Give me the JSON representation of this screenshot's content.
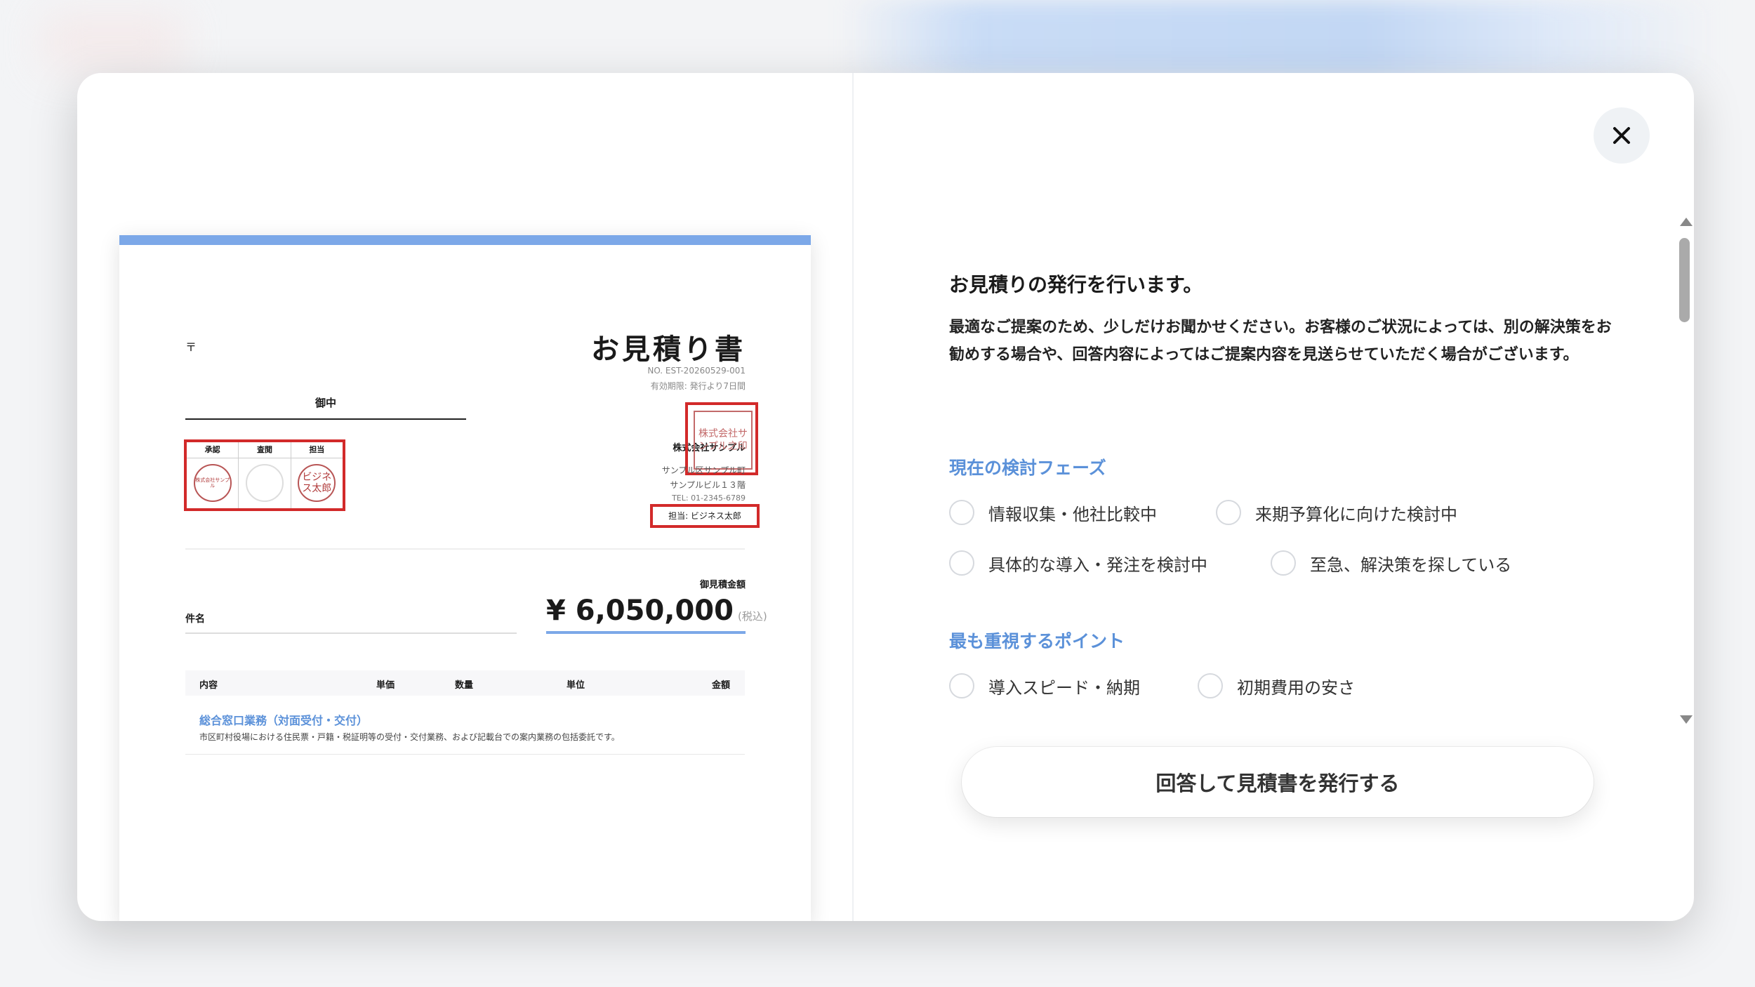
{
  "document": {
    "postal_mark": "〒",
    "title": "お見積り書",
    "number": "NO. EST-20260529-001",
    "validity": "有効期限: 発行より7日間",
    "recipient_suffix": "御中",
    "approval": {
      "headers": [
        "承認",
        "査閲",
        "担当"
      ],
      "seals": [
        "株式会社サンプル",
        "",
        "ビジネス太郎"
      ]
    },
    "company_stamp": "株式会社サンプル之印",
    "company_name": "株式会社サンプル",
    "address_line1": "サンプル区サンプル町",
    "address_line2": "サンプルビル１３階",
    "tel": "TEL: 01-2345-6789",
    "person_in_charge": "担当: ビジネス太郎",
    "amount_label": "御見積金額",
    "subject_label": "件名",
    "amount_value": "¥ 6,050,000",
    "amount_tax": "(税込)",
    "table_headers": [
      "内容",
      "単価",
      "数量",
      "単位",
      "金額"
    ],
    "items": [
      {
        "title": "総合窓口業務（対面受付・交付）",
        "description": "市区町村役場における住民票・戸籍・税証明等の受付・交付業務、および記載台での案内業務の包括委託です。"
      }
    ]
  },
  "form": {
    "title": "お見積りの発行を行います。",
    "intro": "最適なご提案のため、少しだけお聞かせください。お客様のご状況によっては、別の解決策をお勧めする場合や、回答内容によってはご提案内容を見送らせていただく場合がございます。",
    "sections": [
      {
        "title": "現在の検討フェーズ",
        "options": [
          "情報収集・他社比較中",
          "来期予算化に向けた検討中",
          "具体的な導入・発注を検討中",
          "至急、解決策を探している"
        ]
      },
      {
        "title": "最も重視するポイント",
        "options": [
          "導入スピード・納期",
          "初期費用の安さ"
        ]
      }
    ],
    "submit_label": "回答して見積書を発行する"
  },
  "colors": {
    "accent": "#5b91d9",
    "doc_bar": "#7ca8e8",
    "highlight_box": "#d22a2a"
  },
  "icons": {
    "close": "close-icon"
  }
}
